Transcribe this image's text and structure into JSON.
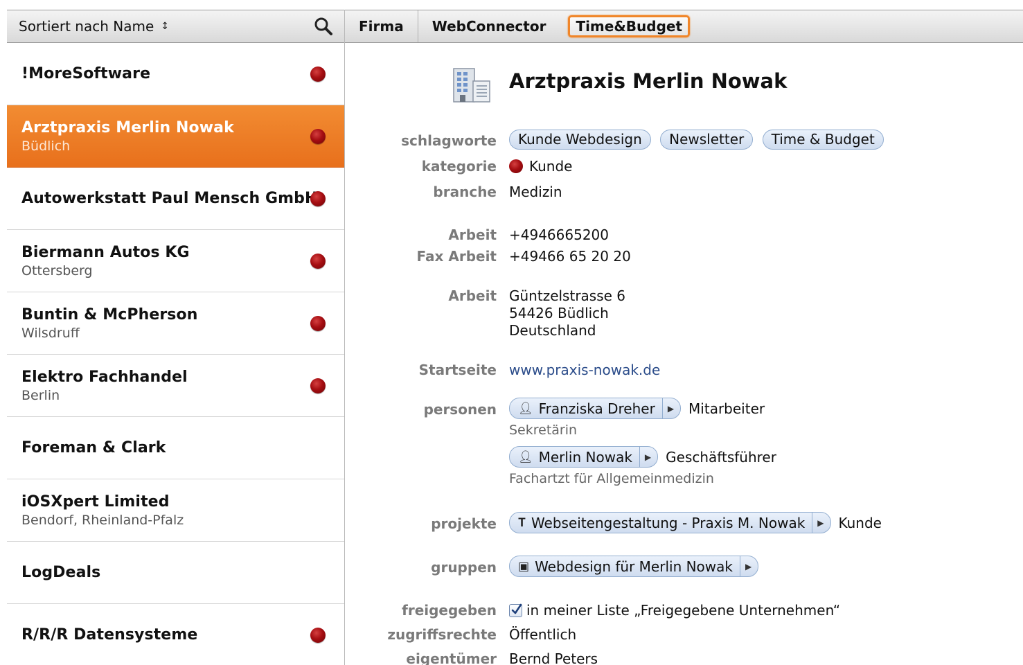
{
  "sidebar": {
    "sort_label": "Sortiert nach Name",
    "sort_icon": "up-down-arrows",
    "search_icon": "magnifier",
    "items": [
      {
        "title": "!MoreSoftware",
        "subtitle": "",
        "has_dot": true
      },
      {
        "title": "Arztpraxis Merlin Nowak",
        "subtitle": "Büdlich",
        "has_dot": true,
        "selected": true
      },
      {
        "title": "Autowerkstatt Paul Mensch GmbH",
        "subtitle": "",
        "has_dot": true
      },
      {
        "title": "Biermann Autos KG",
        "subtitle": "Ottersberg",
        "has_dot": true
      },
      {
        "title": "Buntin & McPherson",
        "subtitle": "Wilsdruff",
        "has_dot": true
      },
      {
        "title": "Elektro Fachhandel",
        "subtitle": "Berlin",
        "has_dot": true
      },
      {
        "title": "Foreman & Clark",
        "subtitle": "",
        "has_dot": false
      },
      {
        "title": "iOSXpert Limited",
        "subtitle": "Bendorf, Rheinland-Pfalz",
        "has_dot": false
      },
      {
        "title": "LogDeals",
        "subtitle": "",
        "has_dot": false
      },
      {
        "title": "R/R/R Datensysteme",
        "subtitle": "",
        "has_dot": true
      }
    ]
  },
  "tabs": {
    "firma": "Firma",
    "webconnector": "WebConnector",
    "timebudget": "Time&Budget",
    "active": "Time&Budget",
    "active_color": "#f0862a"
  },
  "detail": {
    "title": "Arztpraxis Merlin Nowak",
    "icon": "office-building",
    "labels": {
      "schlagworte": "schlagworte",
      "kategorie": "kategorie",
      "branche": "branche",
      "arbeit_tel": "Arbeit",
      "fax": "Fax Arbeit",
      "arbeit_addr": "Arbeit",
      "startseite": "Startseite",
      "personen": "personen",
      "projekte": "projekte",
      "gruppen": "gruppen",
      "freigegeben": "freigegeben",
      "zugriffsrechte": "zugriffsrechte",
      "eigentuemer": "eigentümer"
    },
    "tags": [
      "Kunde Webdesign",
      "Newsletter",
      "Time & Budget"
    ],
    "kategorie": "Kunde",
    "kategorie_color": "#a60e12",
    "branche": "Medizin",
    "phone_work": "+4946665200",
    "fax_work": "+49466 65 20 20",
    "address": {
      "street": "Güntzelstrasse 6",
      "city": "54426 Büdlich",
      "country": "Deutschland"
    },
    "website": "www.praxis-nowak.de",
    "persons": [
      {
        "name": "Franziska Dreher",
        "role": "Mitarbeiter",
        "position": "Sekretärin"
      },
      {
        "name": "Merlin Nowak",
        "role": "Geschäftsführer",
        "position": "Fachartzt für Allgemeinmedizin"
      }
    ],
    "project": {
      "name": "Webseitengestaltung - Praxis M. Nowak",
      "role": "Kunde"
    },
    "group": {
      "name": "Webdesign für Merlin Nowak"
    },
    "freigegeben_text": "in meiner Liste „Freigegebene Unternehmen“",
    "freigegeben_checked": true,
    "zugriffsrechte": "Öffentlich",
    "eigentuemer": "Bernd Peters"
  }
}
